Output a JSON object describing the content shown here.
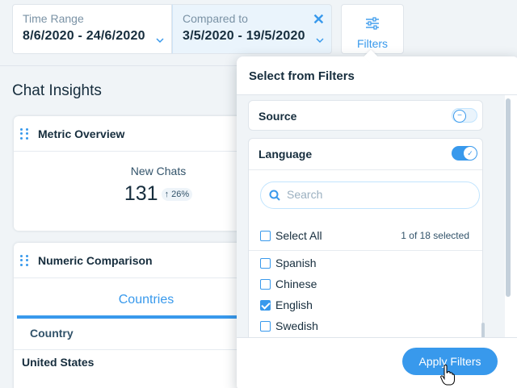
{
  "time_range": {
    "label": "Time Range",
    "value": "8/6/2020 - 24/6/2020"
  },
  "compared_to": {
    "label": "Compared to",
    "value": "3/5/2020 - 19/5/2020"
  },
  "filters_button": {
    "label": "Filters",
    "icon": "sliders-icon"
  },
  "page_title": "Chat Insights",
  "metric_overview": {
    "title": "Metric Overview",
    "metric_label": "New Chats",
    "metric_value": "131",
    "metric_change": "↑ 26%"
  },
  "numeric_comparison": {
    "title": "Numeric Comparison",
    "tab": "Countries",
    "column_header": "Country",
    "rows": [
      "United States"
    ]
  },
  "filter_popover": {
    "title": "Select from Filters",
    "source": {
      "label": "Source",
      "enabled": false
    },
    "language": {
      "label": "Language",
      "enabled": true,
      "search_placeholder": "Search",
      "select_all": "Select All",
      "selected_count": "1 of 18 selected",
      "options": [
        {
          "label": "Spanish",
          "checked": false
        },
        {
          "label": "Chinese",
          "checked": false
        },
        {
          "label": "English",
          "checked": true
        },
        {
          "label": "Swedish",
          "checked": false
        }
      ]
    },
    "apply_label": "Apply Filters"
  },
  "colors": {
    "accent": "#3899ec",
    "text": "#162d3d",
    "background": "#f0f4f7"
  }
}
